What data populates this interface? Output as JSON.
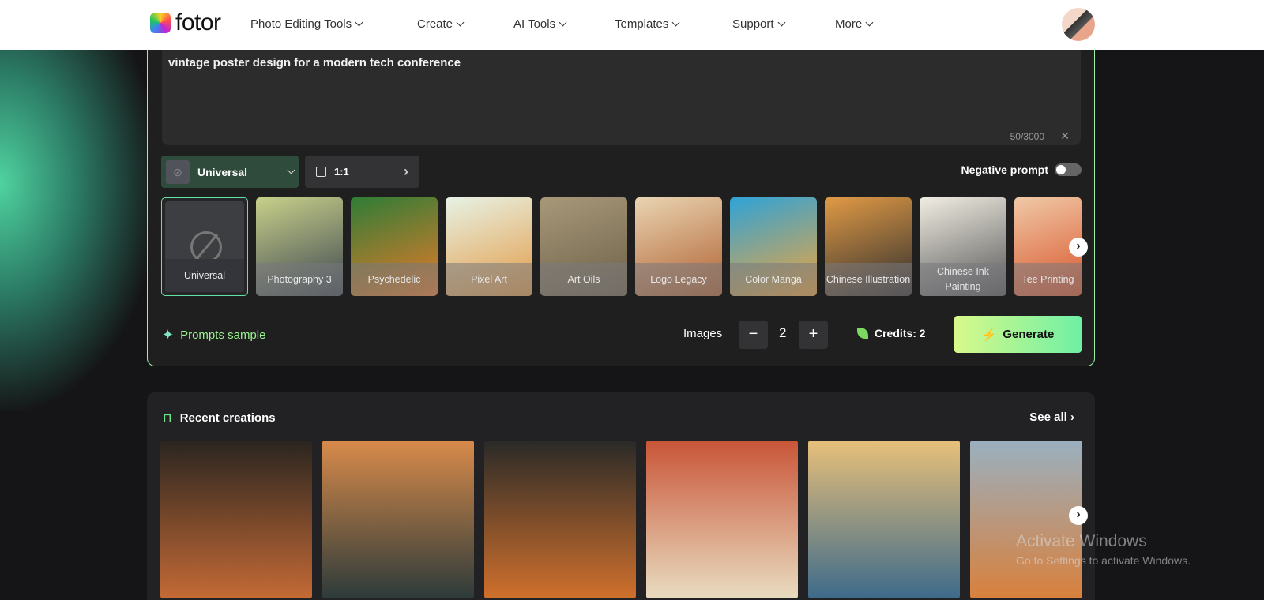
{
  "header": {
    "logo": "fotor",
    "nav": [
      "Photo Editing Tools",
      "Create",
      "AI Tools",
      "Templates",
      "Support",
      "More"
    ]
  },
  "prompt": {
    "value": "vintage poster design for a modern tech conference",
    "counter": "50/3000",
    "clear": "✕"
  },
  "controls": {
    "model": "Universal",
    "ratio": "1:1",
    "negative_prompt": "Negative prompt",
    "negative_prompt_enabled": false
  },
  "styles": [
    {
      "label": "Universal",
      "selected": true
    },
    {
      "label": "Photography 3",
      "colors": [
        "#c8d08a",
        "#3d4650"
      ]
    },
    {
      "label": "Psychedelic",
      "colors": [
        "#2f7d36",
        "#e97a2a"
      ]
    },
    {
      "label": "Pixel Art",
      "colors": [
        "#e7f2e5",
        "#e39a44"
      ]
    },
    {
      "label": "Art Oils",
      "colors": [
        "#a8987a",
        "#6d6148"
      ]
    },
    {
      "label": "Logo Legacy",
      "colors": [
        "#e9d4b2",
        "#b06030"
      ]
    },
    {
      "label": "Color Manga",
      "colors": [
        "#2fa3d8",
        "#f1a43a"
      ]
    },
    {
      "label": "Chinese Illustration",
      "colors": [
        "#e19a45",
        "#2e2e2e"
      ]
    },
    {
      "label": "Chinese Ink Painting",
      "colors": [
        "#f1ede3",
        "#555"
      ]
    },
    {
      "label": "Tee Printing",
      "colors": [
        "#f0c9a7",
        "#d8542a"
      ]
    }
  ],
  "bottom": {
    "prompts_sample": "Prompts sample",
    "images_label": "Images",
    "images_count": "2",
    "minus": "−",
    "plus": "+",
    "credits": "Credits: 2",
    "generate": "Generate"
  },
  "recent": {
    "title": "Recent creations",
    "see_all": "See all",
    "thumbs": [
      [
        "#2a2520",
        "#c46a35"
      ],
      [
        "#d88a4a",
        "#2d3b3a"
      ],
      [
        "#2a2a28",
        "#d0702c"
      ],
      [
        "#c95538",
        "#e9dcc0"
      ],
      [
        "#e8c07a",
        "#3d6a8a"
      ],
      [
        "#9ab0c0",
        "#d8803c"
      ]
    ]
  },
  "watermark": {
    "line1": "Activate Windows",
    "line2": "Go to Settings to activate Windows."
  }
}
